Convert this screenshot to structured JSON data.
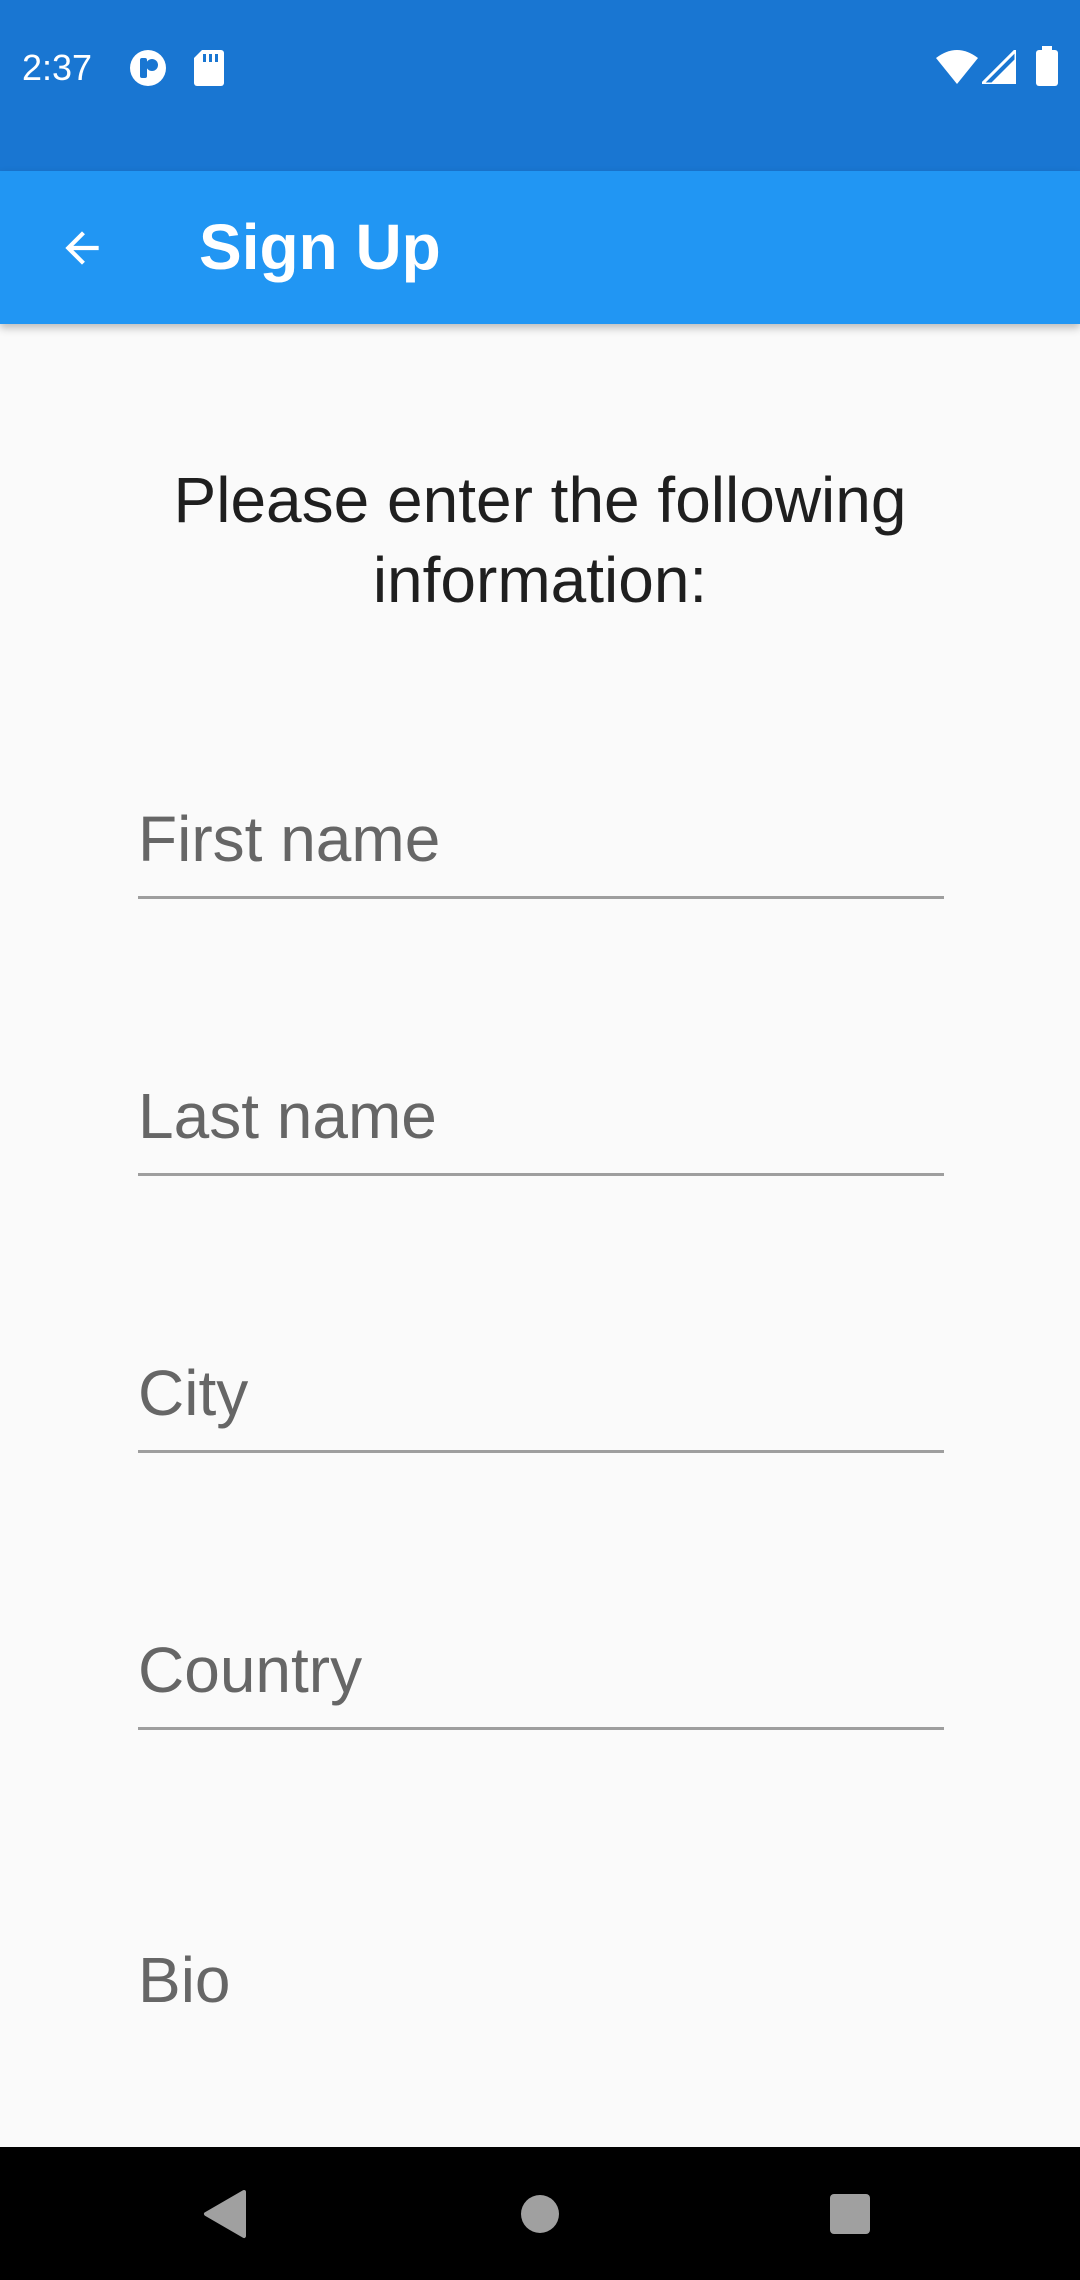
{
  "status_bar": {
    "time": "2:37",
    "icons": [
      "app-notification-icon",
      "sd-card-icon",
      "wifi-icon",
      "cell-signal-icon",
      "battery-icon"
    ]
  },
  "app_bar": {
    "title": "Sign Up",
    "back_icon": "arrow-back-icon",
    "color": "#2196f3"
  },
  "status_color": "#1976d2",
  "form": {
    "instructions": "Please enter the following information:",
    "first_name": {
      "placeholder": "First name",
      "value": ""
    },
    "last_name": {
      "placeholder": "Last name",
      "value": ""
    },
    "city": {
      "placeholder": "City",
      "value": ""
    },
    "country": {
      "placeholder": "Country",
      "value": ""
    },
    "bio": {
      "placeholder": "Bio",
      "value": ""
    }
  },
  "nav_bar": {
    "icons": [
      "back-triangle-icon",
      "home-circle-icon",
      "recents-square-icon"
    ]
  }
}
